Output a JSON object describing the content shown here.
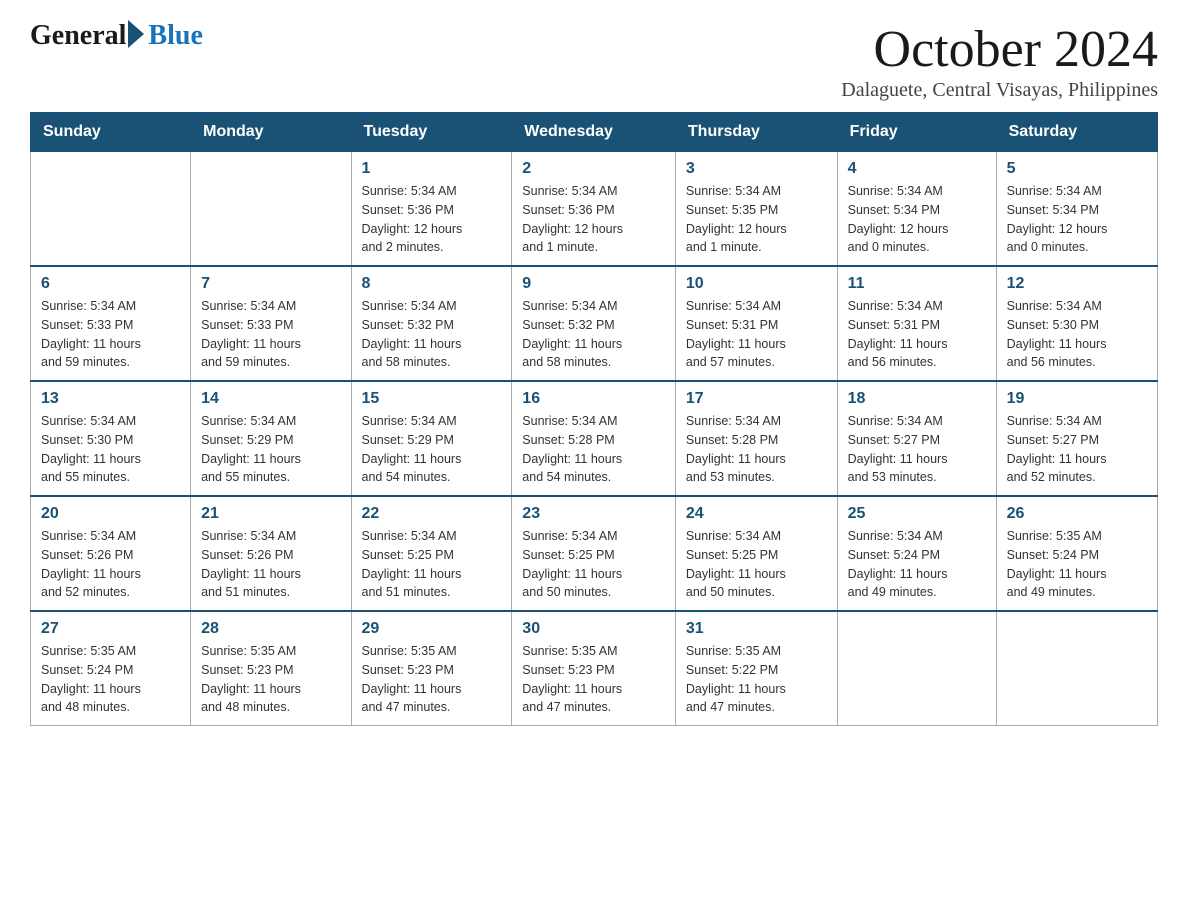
{
  "logo": {
    "general": "General",
    "blue": "Blue"
  },
  "title": "October 2024",
  "location": "Dalaguete, Central Visayas, Philippines",
  "days_header": [
    "Sunday",
    "Monday",
    "Tuesday",
    "Wednesday",
    "Thursday",
    "Friday",
    "Saturday"
  ],
  "weeks": [
    [
      {
        "day": "",
        "info": ""
      },
      {
        "day": "",
        "info": ""
      },
      {
        "day": "1",
        "info": "Sunrise: 5:34 AM\nSunset: 5:36 PM\nDaylight: 12 hours\nand 2 minutes."
      },
      {
        "day": "2",
        "info": "Sunrise: 5:34 AM\nSunset: 5:36 PM\nDaylight: 12 hours\nand 1 minute."
      },
      {
        "day": "3",
        "info": "Sunrise: 5:34 AM\nSunset: 5:35 PM\nDaylight: 12 hours\nand 1 minute."
      },
      {
        "day": "4",
        "info": "Sunrise: 5:34 AM\nSunset: 5:34 PM\nDaylight: 12 hours\nand 0 minutes."
      },
      {
        "day": "5",
        "info": "Sunrise: 5:34 AM\nSunset: 5:34 PM\nDaylight: 12 hours\nand 0 minutes."
      }
    ],
    [
      {
        "day": "6",
        "info": "Sunrise: 5:34 AM\nSunset: 5:33 PM\nDaylight: 11 hours\nand 59 minutes."
      },
      {
        "day": "7",
        "info": "Sunrise: 5:34 AM\nSunset: 5:33 PM\nDaylight: 11 hours\nand 59 minutes."
      },
      {
        "day": "8",
        "info": "Sunrise: 5:34 AM\nSunset: 5:32 PM\nDaylight: 11 hours\nand 58 minutes."
      },
      {
        "day": "9",
        "info": "Sunrise: 5:34 AM\nSunset: 5:32 PM\nDaylight: 11 hours\nand 58 minutes."
      },
      {
        "day": "10",
        "info": "Sunrise: 5:34 AM\nSunset: 5:31 PM\nDaylight: 11 hours\nand 57 minutes."
      },
      {
        "day": "11",
        "info": "Sunrise: 5:34 AM\nSunset: 5:31 PM\nDaylight: 11 hours\nand 56 minutes."
      },
      {
        "day": "12",
        "info": "Sunrise: 5:34 AM\nSunset: 5:30 PM\nDaylight: 11 hours\nand 56 minutes."
      }
    ],
    [
      {
        "day": "13",
        "info": "Sunrise: 5:34 AM\nSunset: 5:30 PM\nDaylight: 11 hours\nand 55 minutes."
      },
      {
        "day": "14",
        "info": "Sunrise: 5:34 AM\nSunset: 5:29 PM\nDaylight: 11 hours\nand 55 minutes."
      },
      {
        "day": "15",
        "info": "Sunrise: 5:34 AM\nSunset: 5:29 PM\nDaylight: 11 hours\nand 54 minutes."
      },
      {
        "day": "16",
        "info": "Sunrise: 5:34 AM\nSunset: 5:28 PM\nDaylight: 11 hours\nand 54 minutes."
      },
      {
        "day": "17",
        "info": "Sunrise: 5:34 AM\nSunset: 5:28 PM\nDaylight: 11 hours\nand 53 minutes."
      },
      {
        "day": "18",
        "info": "Sunrise: 5:34 AM\nSunset: 5:27 PM\nDaylight: 11 hours\nand 53 minutes."
      },
      {
        "day": "19",
        "info": "Sunrise: 5:34 AM\nSunset: 5:27 PM\nDaylight: 11 hours\nand 52 minutes."
      }
    ],
    [
      {
        "day": "20",
        "info": "Sunrise: 5:34 AM\nSunset: 5:26 PM\nDaylight: 11 hours\nand 52 minutes."
      },
      {
        "day": "21",
        "info": "Sunrise: 5:34 AM\nSunset: 5:26 PM\nDaylight: 11 hours\nand 51 minutes."
      },
      {
        "day": "22",
        "info": "Sunrise: 5:34 AM\nSunset: 5:25 PM\nDaylight: 11 hours\nand 51 minutes."
      },
      {
        "day": "23",
        "info": "Sunrise: 5:34 AM\nSunset: 5:25 PM\nDaylight: 11 hours\nand 50 minutes."
      },
      {
        "day": "24",
        "info": "Sunrise: 5:34 AM\nSunset: 5:25 PM\nDaylight: 11 hours\nand 50 minutes."
      },
      {
        "day": "25",
        "info": "Sunrise: 5:34 AM\nSunset: 5:24 PM\nDaylight: 11 hours\nand 49 minutes."
      },
      {
        "day": "26",
        "info": "Sunrise: 5:35 AM\nSunset: 5:24 PM\nDaylight: 11 hours\nand 49 minutes."
      }
    ],
    [
      {
        "day": "27",
        "info": "Sunrise: 5:35 AM\nSunset: 5:24 PM\nDaylight: 11 hours\nand 48 minutes."
      },
      {
        "day": "28",
        "info": "Sunrise: 5:35 AM\nSunset: 5:23 PM\nDaylight: 11 hours\nand 48 minutes."
      },
      {
        "day": "29",
        "info": "Sunrise: 5:35 AM\nSunset: 5:23 PM\nDaylight: 11 hours\nand 47 minutes."
      },
      {
        "day": "30",
        "info": "Sunrise: 5:35 AM\nSunset: 5:23 PM\nDaylight: 11 hours\nand 47 minutes."
      },
      {
        "day": "31",
        "info": "Sunrise: 5:35 AM\nSunset: 5:22 PM\nDaylight: 11 hours\nand 47 minutes."
      },
      {
        "day": "",
        "info": ""
      },
      {
        "day": "",
        "info": ""
      }
    ]
  ]
}
